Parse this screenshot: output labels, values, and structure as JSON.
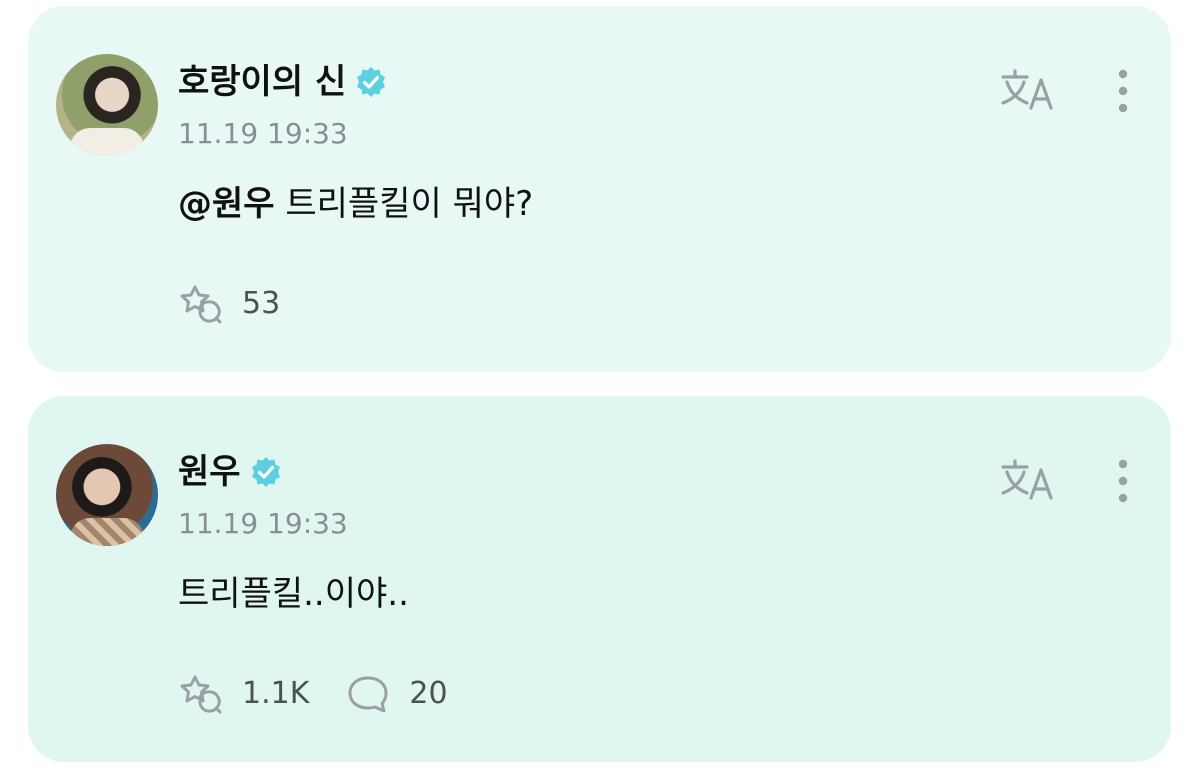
{
  "posts": [
    {
      "author": "호랑이의 신",
      "timestamp": "11.19 19:33",
      "mention": "@원우",
      "text": "트리플킬이 뭐야?",
      "like_count": "53",
      "comment_count": ""
    },
    {
      "author": "원우",
      "timestamp": "11.19 19:33",
      "mention": "",
      "text": "트리플킬..이야..",
      "like_count": "1.1K",
      "comment_count": "20"
    }
  ],
  "icons": {
    "verified": "verified-check-icon",
    "translate": "translate-icon",
    "more": "more-vertical-icon",
    "like": "fan-reaction-icon",
    "comment": "comment-bubble-icon"
  },
  "colors": {
    "post_1_background": "#e7f8f5",
    "post_2_background": "#e0f6f1",
    "verified": "#5ccfe0",
    "muted_text": "#8a8f93",
    "icon_gray": "#9aa0a4"
  }
}
